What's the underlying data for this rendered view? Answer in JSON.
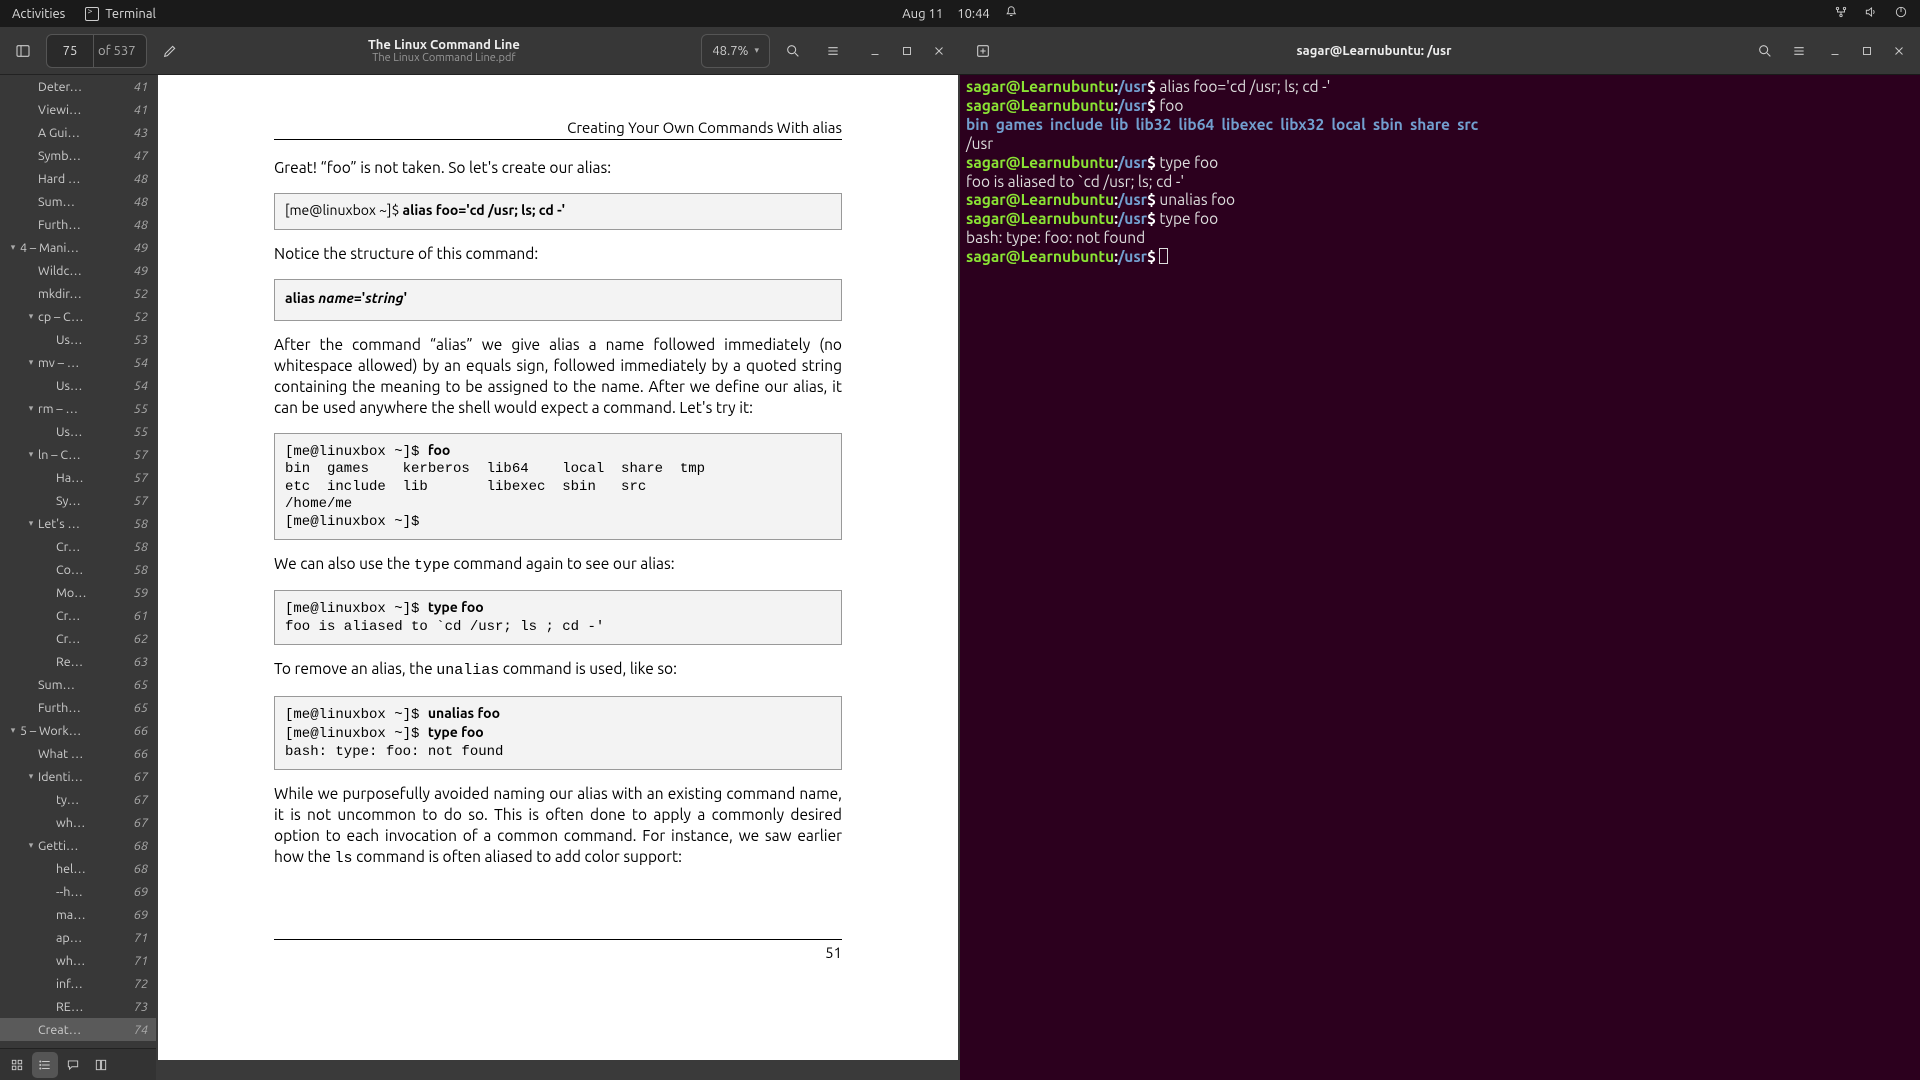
{
  "topbar": {
    "activities": "Activities",
    "app": "Terminal",
    "date": "Aug 11",
    "time": "10:44"
  },
  "pdf": {
    "page_input": "75",
    "page_of": "of 537",
    "title": "The Linux Command Line",
    "file": "The Linux Command Line.pdf",
    "zoom": "48.7%",
    "outline": [
      {
        "indent": 1,
        "exp": false,
        "label": "Deter…",
        "page": "41"
      },
      {
        "indent": 1,
        "exp": false,
        "label": "Viewi…",
        "page": "41"
      },
      {
        "indent": 1,
        "exp": false,
        "label": "A Gui…",
        "page": "43"
      },
      {
        "indent": 1,
        "exp": false,
        "label": "Symb…",
        "page": "47"
      },
      {
        "indent": 1,
        "exp": false,
        "label": "Hard …",
        "page": "48"
      },
      {
        "indent": 1,
        "exp": false,
        "label": "Sum…",
        "page": "48"
      },
      {
        "indent": 1,
        "exp": false,
        "label": "Furth…",
        "page": "48"
      },
      {
        "indent": 0,
        "exp": true,
        "label": "4 – Mani…",
        "page": "49"
      },
      {
        "indent": 1,
        "exp": false,
        "label": "Wildc…",
        "page": "49"
      },
      {
        "indent": 1,
        "exp": false,
        "label": "mkdir…",
        "page": "52"
      },
      {
        "indent": 1,
        "exp": true,
        "label": "cp – C…",
        "page": "52"
      },
      {
        "indent": 2,
        "exp": false,
        "label": "Us…",
        "page": "53"
      },
      {
        "indent": 1,
        "exp": true,
        "label": "mv – …",
        "page": "54"
      },
      {
        "indent": 2,
        "exp": false,
        "label": "Us…",
        "page": "54"
      },
      {
        "indent": 1,
        "exp": true,
        "label": "rm – …",
        "page": "55"
      },
      {
        "indent": 2,
        "exp": false,
        "label": "Us…",
        "page": "55"
      },
      {
        "indent": 1,
        "exp": true,
        "label": "ln – C…",
        "page": "57"
      },
      {
        "indent": 2,
        "exp": false,
        "label": "Ha…",
        "page": "57"
      },
      {
        "indent": 2,
        "exp": false,
        "label": "Sy…",
        "page": "57"
      },
      {
        "indent": 1,
        "exp": true,
        "label": "Let's …",
        "page": "58"
      },
      {
        "indent": 2,
        "exp": false,
        "label": "Cr…",
        "page": "58"
      },
      {
        "indent": 2,
        "exp": false,
        "label": "Co…",
        "page": "58"
      },
      {
        "indent": 2,
        "exp": false,
        "label": "Mo…",
        "page": "59"
      },
      {
        "indent": 2,
        "exp": false,
        "label": "Cr…",
        "page": "61"
      },
      {
        "indent": 2,
        "exp": false,
        "label": "Cr…",
        "page": "62"
      },
      {
        "indent": 2,
        "exp": false,
        "label": "Re…",
        "page": "63"
      },
      {
        "indent": 1,
        "exp": false,
        "label": "Sum…",
        "page": "65"
      },
      {
        "indent": 1,
        "exp": false,
        "label": "Furth…",
        "page": "65"
      },
      {
        "indent": 0,
        "exp": true,
        "label": "5 – Work…",
        "page": "66"
      },
      {
        "indent": 1,
        "exp": false,
        "label": "What …",
        "page": "66"
      },
      {
        "indent": 1,
        "exp": true,
        "label": "Identi…",
        "page": "67"
      },
      {
        "indent": 2,
        "exp": false,
        "label": "ty…",
        "page": "67"
      },
      {
        "indent": 2,
        "exp": false,
        "label": "wh…",
        "page": "67"
      },
      {
        "indent": 1,
        "exp": true,
        "label": "Getti…",
        "page": "68"
      },
      {
        "indent": 2,
        "exp": false,
        "label": "hel…",
        "page": "68"
      },
      {
        "indent": 2,
        "exp": false,
        "label": "--h…",
        "page": "69"
      },
      {
        "indent": 2,
        "exp": false,
        "label": "ma…",
        "page": "69"
      },
      {
        "indent": 2,
        "exp": false,
        "label": "ap…",
        "page": "71"
      },
      {
        "indent": 2,
        "exp": false,
        "label": "wh…",
        "page": "71"
      },
      {
        "indent": 2,
        "exp": false,
        "label": "inf…",
        "page": "72"
      },
      {
        "indent": 2,
        "exp": false,
        "label": "RE…",
        "page": "73"
      },
      {
        "indent": 1,
        "exp": false,
        "label": "Creat…",
        "page": "74",
        "active": true
      }
    ],
    "content": {
      "section": "Creating Your Own Commands With alias",
      "p1": "Great! “foo” is not taken. So let's create our alias:",
      "code1_pre": "[me@linuxbox ~]$ ",
      "code1_cmd": "alias foo='cd /usr; ls; cd -'",
      "p2": "Notice the structure of this command:",
      "code2_cmd": "alias ",
      "code2_name": "name",
      "code2_eq": "='",
      "code2_str": "string",
      "code2_tail": "'",
      "p3": "After the command “alias” we give alias a name followed immediately (no whitespace allowed) by an equals sign, followed immediately by a quoted string containing the meaning to be assigned to the name. After we define our alias, it can be used anywhere the shell would expect a command. Let's try it:",
      "code3": "[me@linuxbox ~]$ <b>foo</b>\nbin  games    kerberos  lib64    local  share  tmp\netc  include  lib       libexec  sbin   src\n/home/me\n[me@linuxbox ~]$",
      "p4a": "We can also use the ",
      "p4_mono": "type",
      "p4b": " command again to see our alias:",
      "code4": "[me@linuxbox ~]$ <b>type foo</b>\nfoo is aliased to `cd /usr; ls ; cd -'",
      "p5a": "To remove an alias, the ",
      "p5_mono": "unalias",
      "p5b": " command is used, like so:",
      "code5": "[me@linuxbox ~]$ <b>unalias foo</b>\n[me@linuxbox ~]$ <b>type foo</b>\nbash: type: foo: not found",
      "p6a": "While we purposefully avoided naming our alias with an existing command name, it is not uncommon to do so. This is often done to apply a commonly desired option to each invocation of a common command. For instance, we saw earlier how the ",
      "p6_mono": "ls",
      "p6b": " command is often aliased to add color support:",
      "footer": "51"
    }
  },
  "terminal": {
    "title": "sagar@Learnubuntu: /usr",
    "prompt": {
      "user": "sagar@Learnubuntu",
      "colon": ":",
      "path": "/usr",
      "dollar": "$"
    },
    "ls_items": [
      "bin",
      "games",
      "include",
      "lib",
      "lib32",
      "lib64",
      "libexec",
      "libx32",
      "local",
      "sbin",
      "share",
      "src"
    ],
    "lines": [
      {
        "type": "cmd",
        "text": "alias foo='cd /usr; ls; cd -'"
      },
      {
        "type": "cmd",
        "text": "foo"
      },
      {
        "type": "ls"
      },
      {
        "type": "out",
        "text": "/usr"
      },
      {
        "type": "cmd",
        "text": "type foo"
      },
      {
        "type": "out",
        "text": "foo is aliased to `cd /usr; ls; cd -'"
      },
      {
        "type": "cmd",
        "text": "unalias foo"
      },
      {
        "type": "cmd",
        "text": "type foo"
      },
      {
        "type": "out",
        "text": "bash: type: foo: not found"
      },
      {
        "type": "cursor"
      }
    ]
  }
}
